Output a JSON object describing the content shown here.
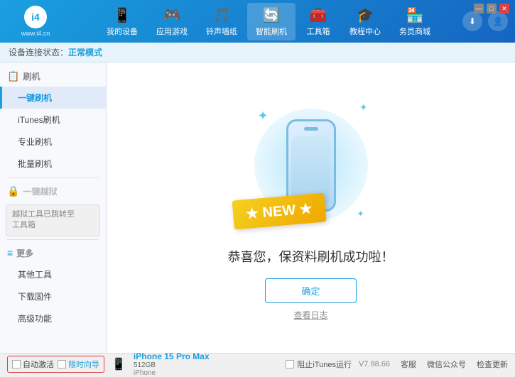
{
  "app": {
    "logo_text": "www.i4.cn",
    "logo_display": "i4"
  },
  "nav": {
    "items": [
      {
        "id": "my-device",
        "label": "我的设备",
        "icon": "📱"
      },
      {
        "id": "apps",
        "label": "应用游戏",
        "icon": "🎮"
      },
      {
        "id": "ringtone",
        "label": "铃声墙纸",
        "icon": "🎵"
      },
      {
        "id": "smart-flash",
        "label": "智能刷机",
        "icon": "🔄",
        "active": true
      },
      {
        "id": "toolbox",
        "label": "工具箱",
        "icon": "🧰"
      },
      {
        "id": "tutorial",
        "label": "教程中心",
        "icon": "🎓"
      },
      {
        "id": "store",
        "label": "务员商城",
        "icon": "🏪"
      }
    ]
  },
  "status": {
    "label": "设备连接状态：",
    "mode": "正常模式"
  },
  "sidebar": {
    "sections": [
      {
        "id": "flash",
        "header": "刷机",
        "header_icon": "📋",
        "items": [
          {
            "id": "one-click",
            "label": "一键刷机",
            "active": true
          },
          {
            "id": "itunes",
            "label": "iTunes刷机"
          },
          {
            "id": "pro",
            "label": "专业刷机"
          },
          {
            "id": "batch",
            "label": "批量刷机"
          }
        ]
      },
      {
        "id": "one-step",
        "header_disabled": "一键越狱",
        "disabled_box": "越狱工具已跳转至\n工具箱"
      },
      {
        "id": "more",
        "header": "更多",
        "header_icon": "≡",
        "items": [
          {
            "id": "other-tools",
            "label": "其他工具"
          },
          {
            "id": "download-fw",
            "label": "下载固件"
          },
          {
            "id": "advanced",
            "label": "高级功能"
          }
        ]
      }
    ]
  },
  "content": {
    "success_text": "恭喜您，保资料刷机成功啦！",
    "confirm_button": "确定",
    "view_log": "查看日志",
    "new_label": "★ NEW ★"
  },
  "bottom": {
    "checkboxes": [
      {
        "id": "auto-activate",
        "label": "自动激活"
      },
      {
        "id": "time-guide",
        "label": "限时向导"
      }
    ],
    "device": {
      "icon": "📱",
      "name": "iPhone 15 Pro Max",
      "storage": "512GB",
      "type": "iPhone"
    },
    "itunes_stop": "阻止iTunes运行",
    "version": "V7.98.66",
    "links": [
      "客服",
      "微信公众号",
      "检查更新"
    ]
  },
  "window_controls": {
    "minimize": "—",
    "maximize": "□",
    "close": "✕"
  }
}
